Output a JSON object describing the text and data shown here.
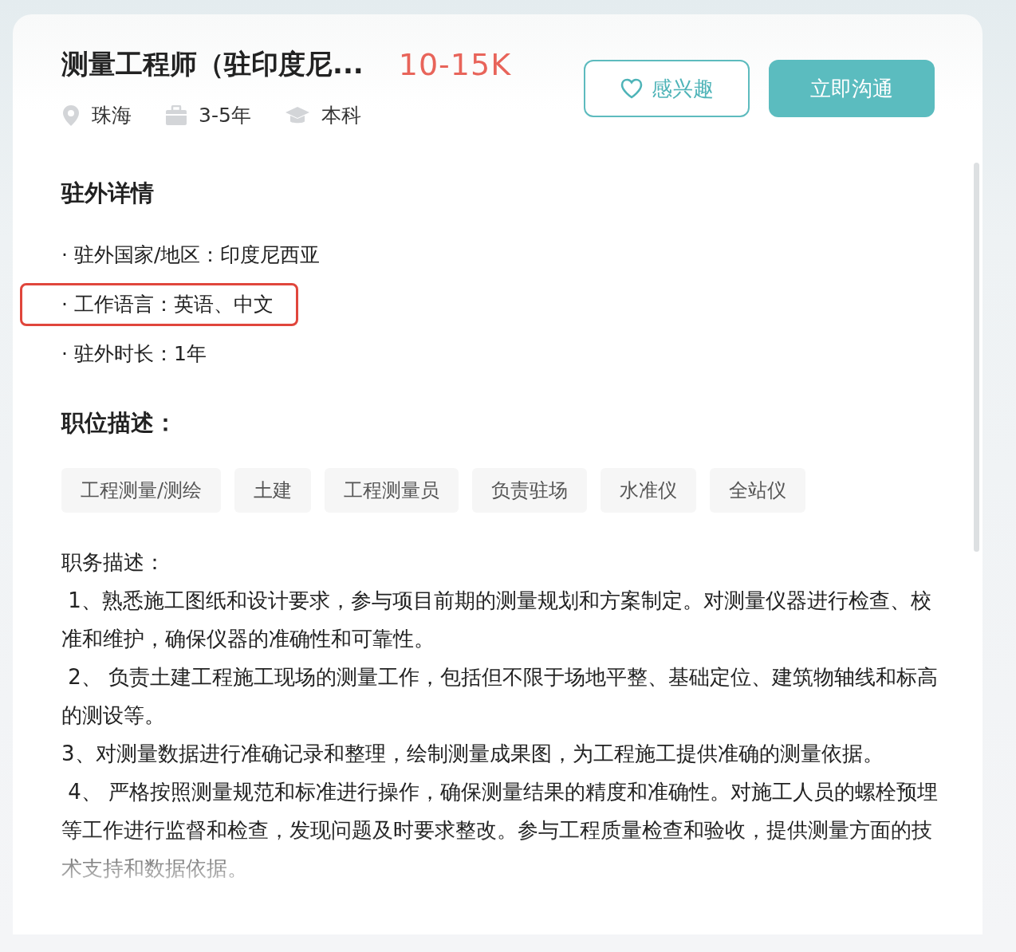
{
  "job": {
    "title": "测量工程师（驻印度尼...",
    "salary": "10-15K",
    "meta": [
      {
        "kind": "location",
        "text": "珠海"
      },
      {
        "kind": "experience",
        "text": "3-5年"
      },
      {
        "kind": "education",
        "text": "本科"
      }
    ]
  },
  "buttons": [
    {
      "kind": "interest",
      "label": "感兴趣"
    },
    {
      "kind": "chat",
      "label": "立即沟通"
    }
  ],
  "overseas": {
    "heading": "驻外详情",
    "items": [
      {
        "text": "· 驻外国家/地区：印度尼西亚",
        "highlighted": false
      },
      {
        "text": "· 工作语言：英语、中文",
        "highlighted": true
      },
      {
        "text": "· 驻外时长：1年",
        "highlighted": false
      }
    ]
  },
  "description": {
    "heading": "职位描述：",
    "tags": [
      "工程测量/测绘",
      "土建",
      "工程测量员",
      "负责驻场",
      "水准仪",
      "全站仪"
    ],
    "paragraphs": [
      "职务描述：",
      " 1、熟悉施工图纸和设计要求，参与项目前期的测量规划和方案制定。对测量仪器进行检查、校准和维护，确保仪器的准确性和可靠性。",
      " 2、 负责土建工程施工现场的测量工作，包括但不限于场地平整、基础定位、建筑物轴线和标高的测设等。",
      "3、对测量数据进行准确记录和整理，绘制测量成果图，为工程施工提供准确的测量依据。",
      " 4、 严格按照测量规范和标准进行操作，确保测量结果的精度和准确性。对施工人员的螺栓预埋等工作进行监督和检查，发现问题及时要求整改。参与工程质量检查和验收，提供测量方面的技术支持和数据依据。"
    ]
  }
}
